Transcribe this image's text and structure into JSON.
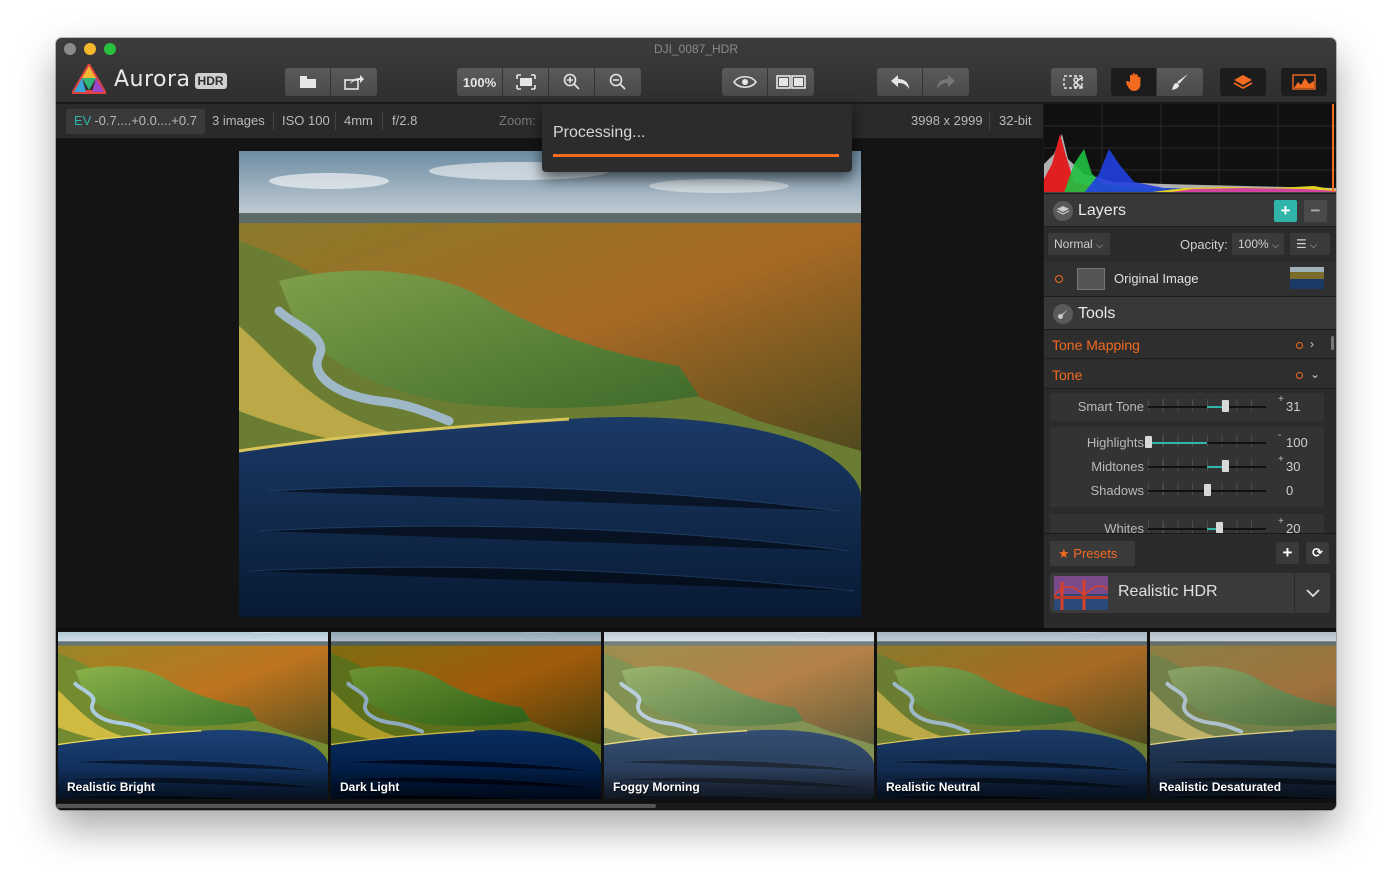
{
  "window": {
    "title": "DJI_0087_HDR"
  },
  "app": {
    "name": "Aurora",
    "badge": "HDR"
  },
  "toolbar": {
    "zoom_label": "100%",
    "icons": [
      "open-icon",
      "share-icon",
      "fit-screen-icon",
      "zoom-in-icon",
      "zoom-out-icon",
      "preview-eye-icon",
      "compare-icon",
      "undo-icon",
      "redo-icon",
      "crop-icon",
      "hand-icon",
      "brush-icon",
      "layers-icon",
      "histogram-icon"
    ]
  },
  "info": {
    "ev_label": "EV",
    "ev_value": "-0.7....+0.0....+0.7",
    "images": "3 images",
    "iso": "ISO 100",
    "focal": "4mm",
    "aperture": "f/2.8",
    "zoom_label": "Zoom:",
    "dimensions": "3998 x 2999",
    "bitdepth": "32-bit"
  },
  "processing": {
    "text": "Processing...",
    "progress": 1.0
  },
  "layers": {
    "title": "Layers",
    "blend_mode": "Normal",
    "opacity_label": "Opacity:",
    "opacity_value": "100%",
    "items": [
      {
        "name": "Original Image"
      }
    ]
  },
  "tools": {
    "title": "Tools",
    "filters": [
      {
        "name": "Tone Mapping",
        "expanded": false
      },
      {
        "name": "Tone",
        "expanded": true
      }
    ],
    "sliders": [
      {
        "label": "Smart Tone",
        "value": "31",
        "sign": "+",
        "level": 0.65
      },
      {
        "label": "Highlights",
        "value": "100",
        "sign": "-",
        "level": 0.0
      },
      {
        "label": "Midtones",
        "value": "30",
        "sign": "+",
        "level": 0.65
      },
      {
        "label": "Shadows",
        "value": "0",
        "sign": "",
        "level": 0.5
      },
      {
        "label": "Whites",
        "value": "20",
        "sign": "+",
        "level": 0.6
      }
    ]
  },
  "presets": {
    "button_label": "Presets",
    "selected": "Realistic HDR"
  },
  "filmstrip": {
    "items": [
      {
        "label": "Realistic Bright",
        "selected": false
      },
      {
        "label": "Dark Light",
        "selected": true
      },
      {
        "label": "Foggy Morning",
        "selected": false
      },
      {
        "label": "Realistic Neutral",
        "selected": false
      },
      {
        "label": "Realistic Desaturated",
        "selected": false
      }
    ]
  },
  "colors": {
    "accent": "#f26b21",
    "teal": "#2fb5a9",
    "add_button": "#2fb5a9"
  }
}
